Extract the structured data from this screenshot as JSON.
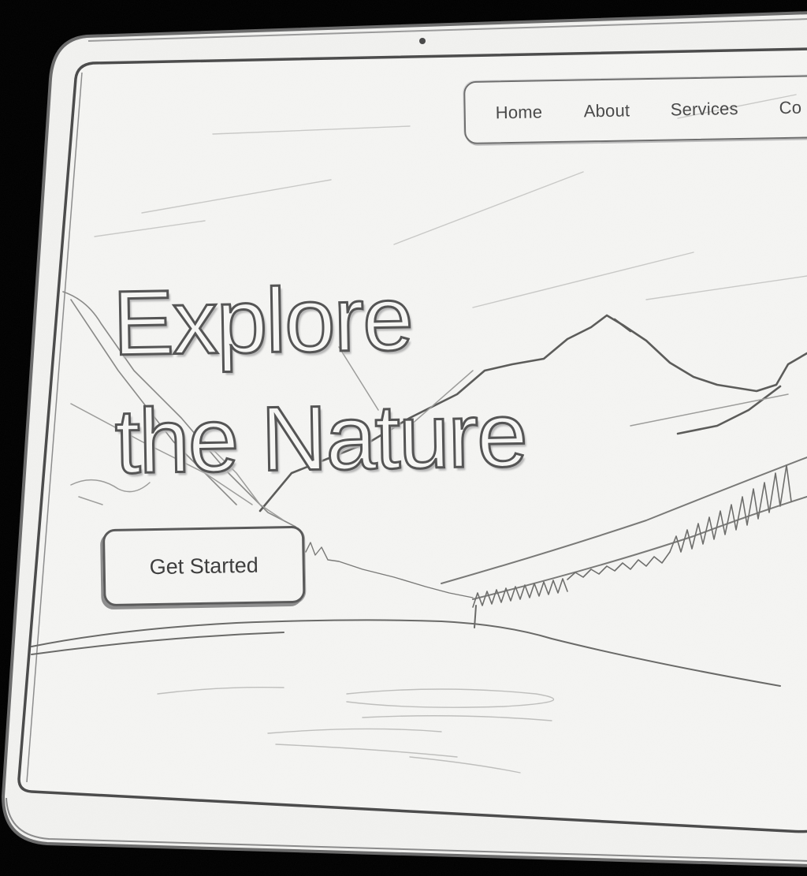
{
  "nav": {
    "items": [
      {
        "label": "Home"
      },
      {
        "label": "About"
      },
      {
        "label": "Services"
      },
      {
        "label": "Co"
      }
    ]
  },
  "hero": {
    "title_line1": "Explore",
    "title_line2": "the Nature",
    "cta_label": "Get Started"
  },
  "colors": {
    "paper": "#f4f4f2",
    "pencil": "#555555",
    "background": "#000000"
  },
  "icons": {
    "camera": "camera-dot-icon"
  }
}
